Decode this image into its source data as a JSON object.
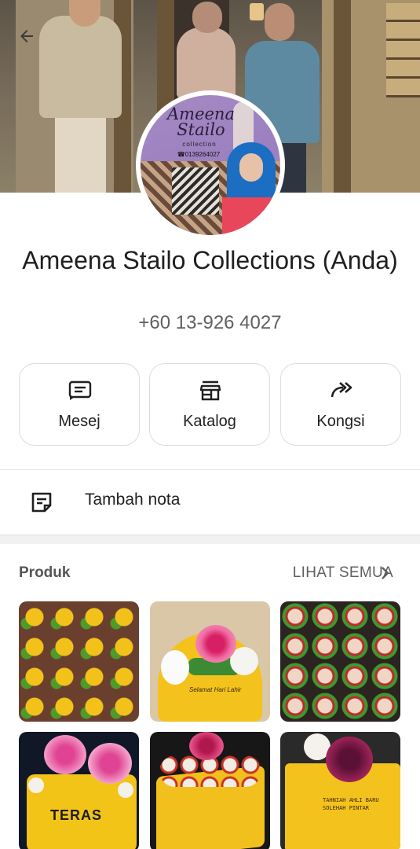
{
  "profile": {
    "name": "Ameena Stailo Collections (Anda)",
    "phone": "+60 13-926 4027",
    "avatar": {
      "brand": "Ameena Stailo",
      "sub": "collection",
      "phone": "☎0139264027"
    }
  },
  "actions": [
    {
      "label": "Mesej",
      "icon": "message-icon"
    },
    {
      "label": "Katalog",
      "icon": "storefront-icon"
    },
    {
      "label": "Kongsi",
      "icon": "forward-icon"
    }
  ],
  "note": {
    "label": "Tambah nota",
    "icon": "note-add-icon"
  },
  "products": {
    "title": "Produk",
    "see_all": "LIHAT SEMUA",
    "tile4_text": "TERAS",
    "tile2_text": "Selamat Hari Lahir",
    "tile6_text": "TAHNIAH AHLI BARU SOLEHAH PINTAR"
  },
  "colors": {
    "primary_text": "#1f1f1f",
    "secondary_text": "#606060",
    "border": "#dcdcdc",
    "section_gap": "#f1f1f1"
  }
}
